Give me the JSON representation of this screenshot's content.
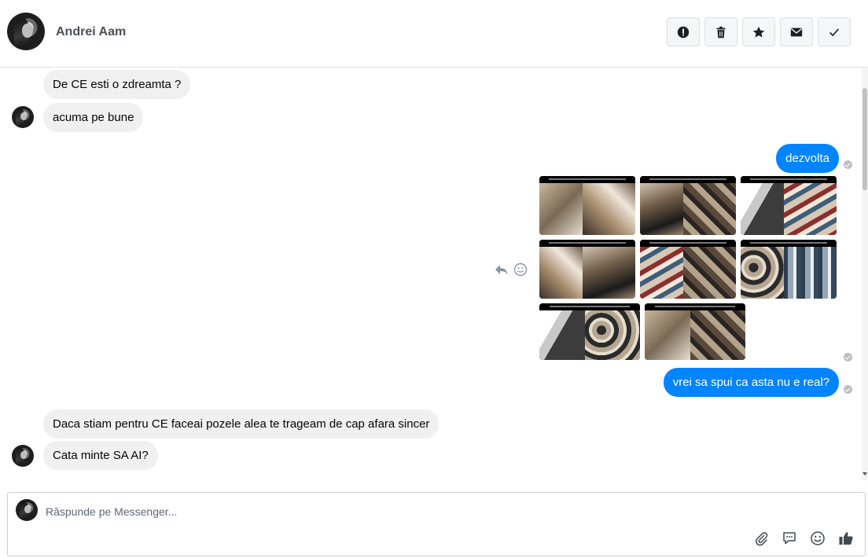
{
  "header": {
    "contact_name": "Andrei Aam",
    "actions": [
      {
        "name": "report-button",
        "icon": "exclamation-circle-icon"
      },
      {
        "name": "delete-button",
        "icon": "trash-icon"
      },
      {
        "name": "star-button",
        "icon": "star-icon"
      },
      {
        "name": "mark-unread-button",
        "icon": "envelope-icon"
      },
      {
        "name": "mark-done-button",
        "icon": "checkmark-icon"
      }
    ]
  },
  "messages": {
    "incoming_top": [
      {
        "text": "De CE esti o zdreamta ?"
      },
      {
        "text": "acuma pe bune"
      }
    ],
    "outgoing": [
      {
        "text": "dezvolta"
      },
      {
        "text": "vrei sa spui ca asta nu e real?"
      }
    ],
    "photos_count": 8,
    "incoming_bottom": [
      {
        "text": "Daca stiam pentru CE faceai pozele alea te trageam de cap afara sincer"
      },
      {
        "text": "Cata minte SA AI?"
      }
    ]
  },
  "composer": {
    "placeholder": "Răspunde pe Messenger..."
  },
  "colors": {
    "outgoing_bubble": "#0084ff",
    "incoming_bubble": "#f1f0f0",
    "icon_gray": "#444950"
  }
}
